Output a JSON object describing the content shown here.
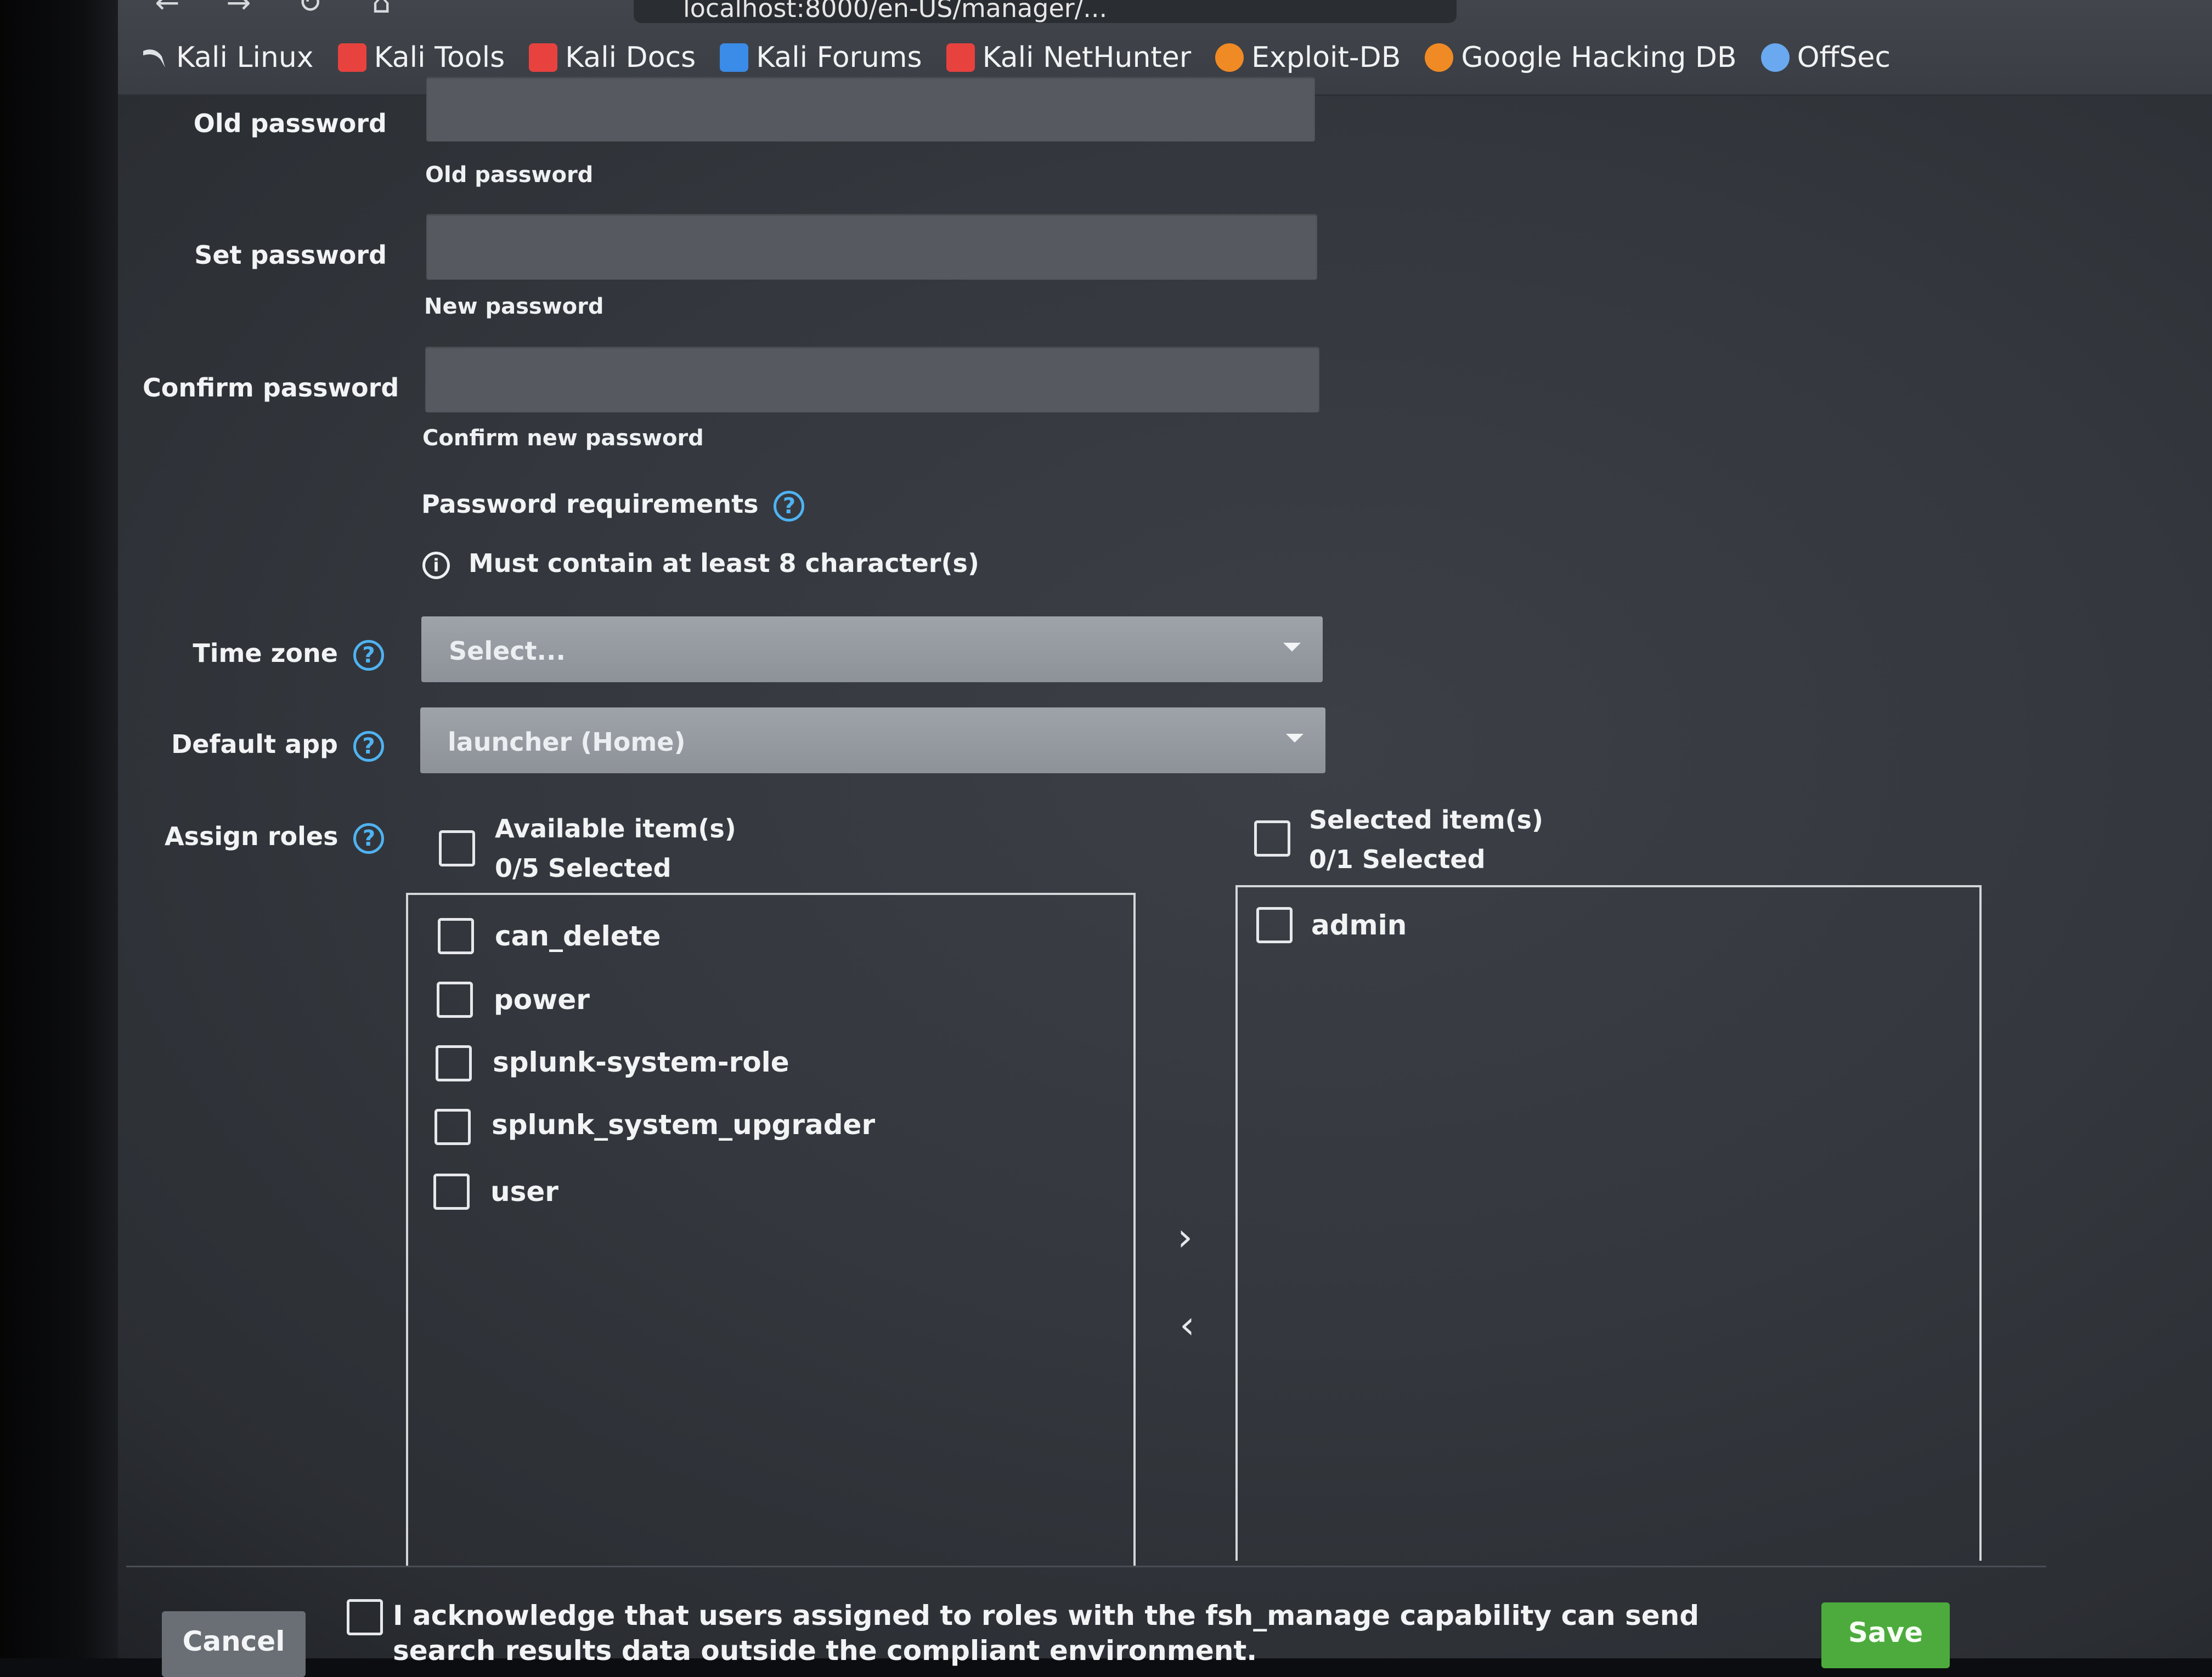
{
  "browser": {
    "url": "localhost:8000/en-US/manager/...",
    "bookmarks": [
      {
        "label": "Kali Linux",
        "icon": "kali-dragon-icon",
        "color": "#e9ecef"
      },
      {
        "label": "Kali Tools",
        "icon": "kali-tools-icon",
        "color": "#e8423f"
      },
      {
        "label": "Kali Docs",
        "icon": "kali-docs-icon",
        "color": "#e8423f"
      },
      {
        "label": "Kali Forums",
        "icon": "kali-forums-icon",
        "color": "#3b8be8"
      },
      {
        "label": "Kali NetHunter",
        "icon": "nethunter-icon",
        "color": "#e8423f"
      },
      {
        "label": "Exploit-DB",
        "icon": "exploit-db-icon",
        "color": "#f08a24"
      },
      {
        "label": "Google Hacking DB",
        "icon": "ghdb-icon",
        "color": "#f08a24"
      },
      {
        "label": "OffSec",
        "icon": "offsec-icon",
        "color": "#6aa8f0"
      }
    ]
  },
  "form": {
    "old_password": {
      "label": "Old password",
      "hint": "Old password",
      "value": ""
    },
    "set_password": {
      "label": "Set password",
      "hint": "New password",
      "value": ""
    },
    "confirm_password": {
      "label": "Confirm password",
      "hint": "Confirm new password",
      "value": ""
    },
    "requirements": {
      "title": "Password requirements",
      "items": [
        "Must contain at least 8 character(s)"
      ]
    },
    "time_zone": {
      "label": "Time zone",
      "value": "Select..."
    },
    "default_app": {
      "label": "Default app",
      "value": "launcher (Home)"
    },
    "assign_roles": {
      "label": "Assign roles",
      "available": {
        "title": "Available item(s)",
        "count": "0/5 Selected",
        "items": [
          "can_delete",
          "power",
          "splunk-system-role",
          "splunk_system_upgrader",
          "user"
        ]
      },
      "selected": {
        "title": "Selected item(s)",
        "count": "0/1 Selected",
        "items": [
          "admin"
        ]
      },
      "move_right": "›",
      "move_left": "‹"
    }
  },
  "footer": {
    "cancel_label": "Cancel",
    "acknowledge_text": "I acknowledge that users assigned to roles with the fsh_manage capability can send search results data outside the compliant environment.",
    "save_label": "Save"
  },
  "colors": {
    "help_icon": "#4fb3f2",
    "save_button": "#4cab3c",
    "input_bg": "#565a60"
  }
}
